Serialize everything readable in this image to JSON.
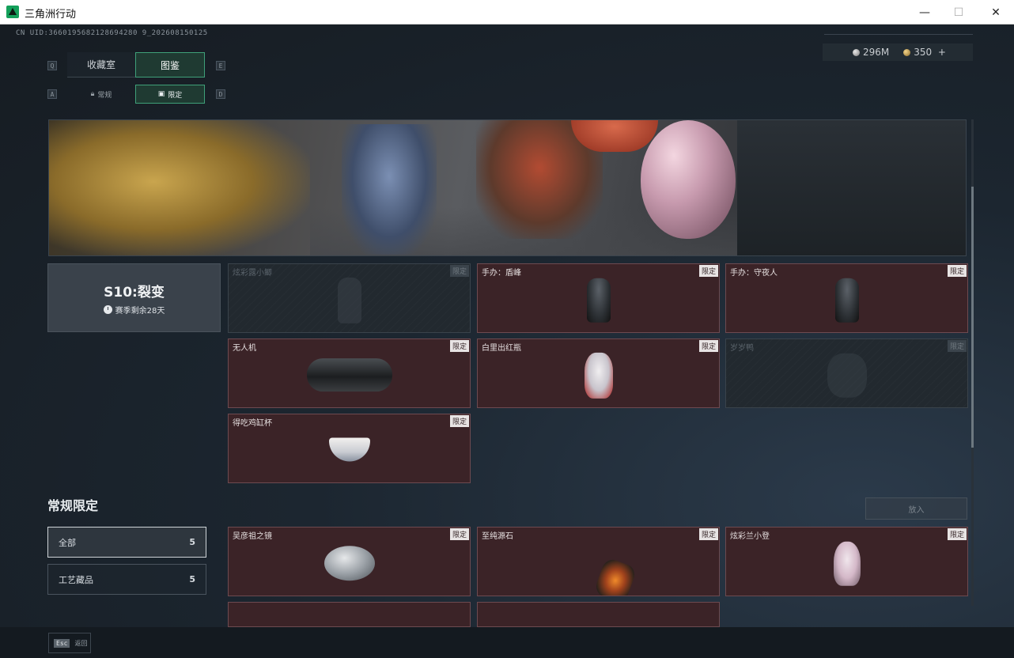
{
  "window": {
    "title": "三角洲行动",
    "minimize": "—",
    "maximize": "☐",
    "close": "✕"
  },
  "uid": "CN UID:3660195682128694280 9_202608150125",
  "currency": {
    "silver": "296M",
    "gold": "350",
    "add": "+"
  },
  "keys": {
    "q": "Q",
    "e": "E",
    "a": "A",
    "d": "D"
  },
  "main_tabs": [
    {
      "label": "收藏室",
      "active": false
    },
    {
      "label": "图鉴",
      "active": true
    }
  ],
  "sub_tabs": [
    {
      "label": "常规",
      "icon": "lock-icon",
      "active": false
    },
    {
      "label": "限定",
      "icon": "card-icon",
      "active": true
    }
  ],
  "season": {
    "title": "S10:裂变",
    "remaining": "赛季剩余28天"
  },
  "season_items": [
    {
      "name": "炫彩露小鲫",
      "tag": "限定",
      "locked": true,
      "art": "figure-ghost"
    },
    {
      "name": "手办：盾峰",
      "tag": "限定",
      "locked": false,
      "art": "figure-dark"
    },
    {
      "name": "手办：守夜人",
      "tag": "限定",
      "locked": false,
      "art": "figure-dark"
    },
    {
      "name": "无人机",
      "tag": "限定",
      "locked": false,
      "art": "drone"
    },
    {
      "name": "白里出红瓶",
      "tag": "限定",
      "locked": false,
      "art": "vase"
    },
    {
      "name": "岁岁鸭",
      "tag": "限定",
      "locked": true,
      "art": "duck"
    },
    {
      "name": "得吃鸡缸杯",
      "tag": "限定",
      "locked": false,
      "art": "bowl"
    }
  ],
  "regular_section": {
    "title": "常规限定",
    "place_button": "放入",
    "filters": [
      {
        "label": "全部",
        "count": "5",
        "active": true
      },
      {
        "label": "工艺藏品",
        "count": "5",
        "active": false
      }
    ],
    "items": [
      {
        "name": "吴彦祖之镜",
        "tag": "限定",
        "art": "mirror"
      },
      {
        "name": "至纯源石",
        "tag": "限定",
        "art": "stone"
      },
      {
        "name": "炫彩兰小登",
        "tag": "限定",
        "art": "stool"
      }
    ]
  },
  "footer": {
    "esc_key": "Esc",
    "back_label": "返回"
  }
}
